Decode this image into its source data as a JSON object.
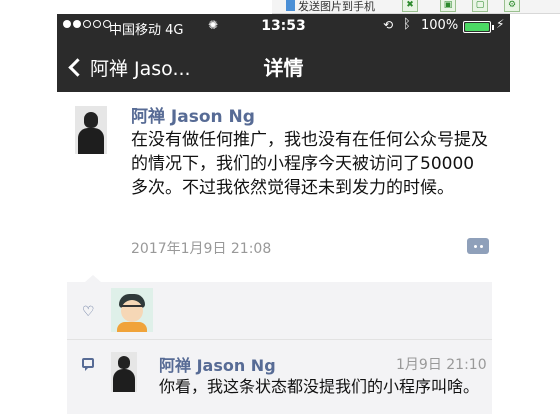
{
  "toolbar": {
    "file_label": "发送图片到手机",
    "btn1": "✖",
    "btn2": "▣",
    "btn3": "▢",
    "btn4": "⚙"
  },
  "status_bar": {
    "carrier": "中国移动",
    "network": "4G",
    "time": "13:53",
    "battery_percent": "100%",
    "battery_level": 1.0
  },
  "nav": {
    "back_label": "阿禅 Jaso...",
    "title": "详情"
  },
  "post": {
    "author": "阿禅 Jason Ng",
    "content": "在没有做任何推广，我也没有在任何公众号提及的情况下，我们的小程序今天被访问了50000多次。不过我依然觉得还未到发力的时候。",
    "timestamp": "2017年1月9日 21:08"
  },
  "comments": [
    {
      "author": "阿禅 Jason Ng",
      "time": "1月9日 21:10",
      "text": "你看，我这条状态都没提我们的小程序叫啥。"
    }
  ],
  "icons": {
    "back": "chevron-left-icon",
    "heart": "heart-icon",
    "comment": "comment-icon",
    "more": "more-icon"
  },
  "colors": {
    "nav_bg": "#2b2b2b",
    "link": "#576b95",
    "battery": "#4cd964"
  }
}
